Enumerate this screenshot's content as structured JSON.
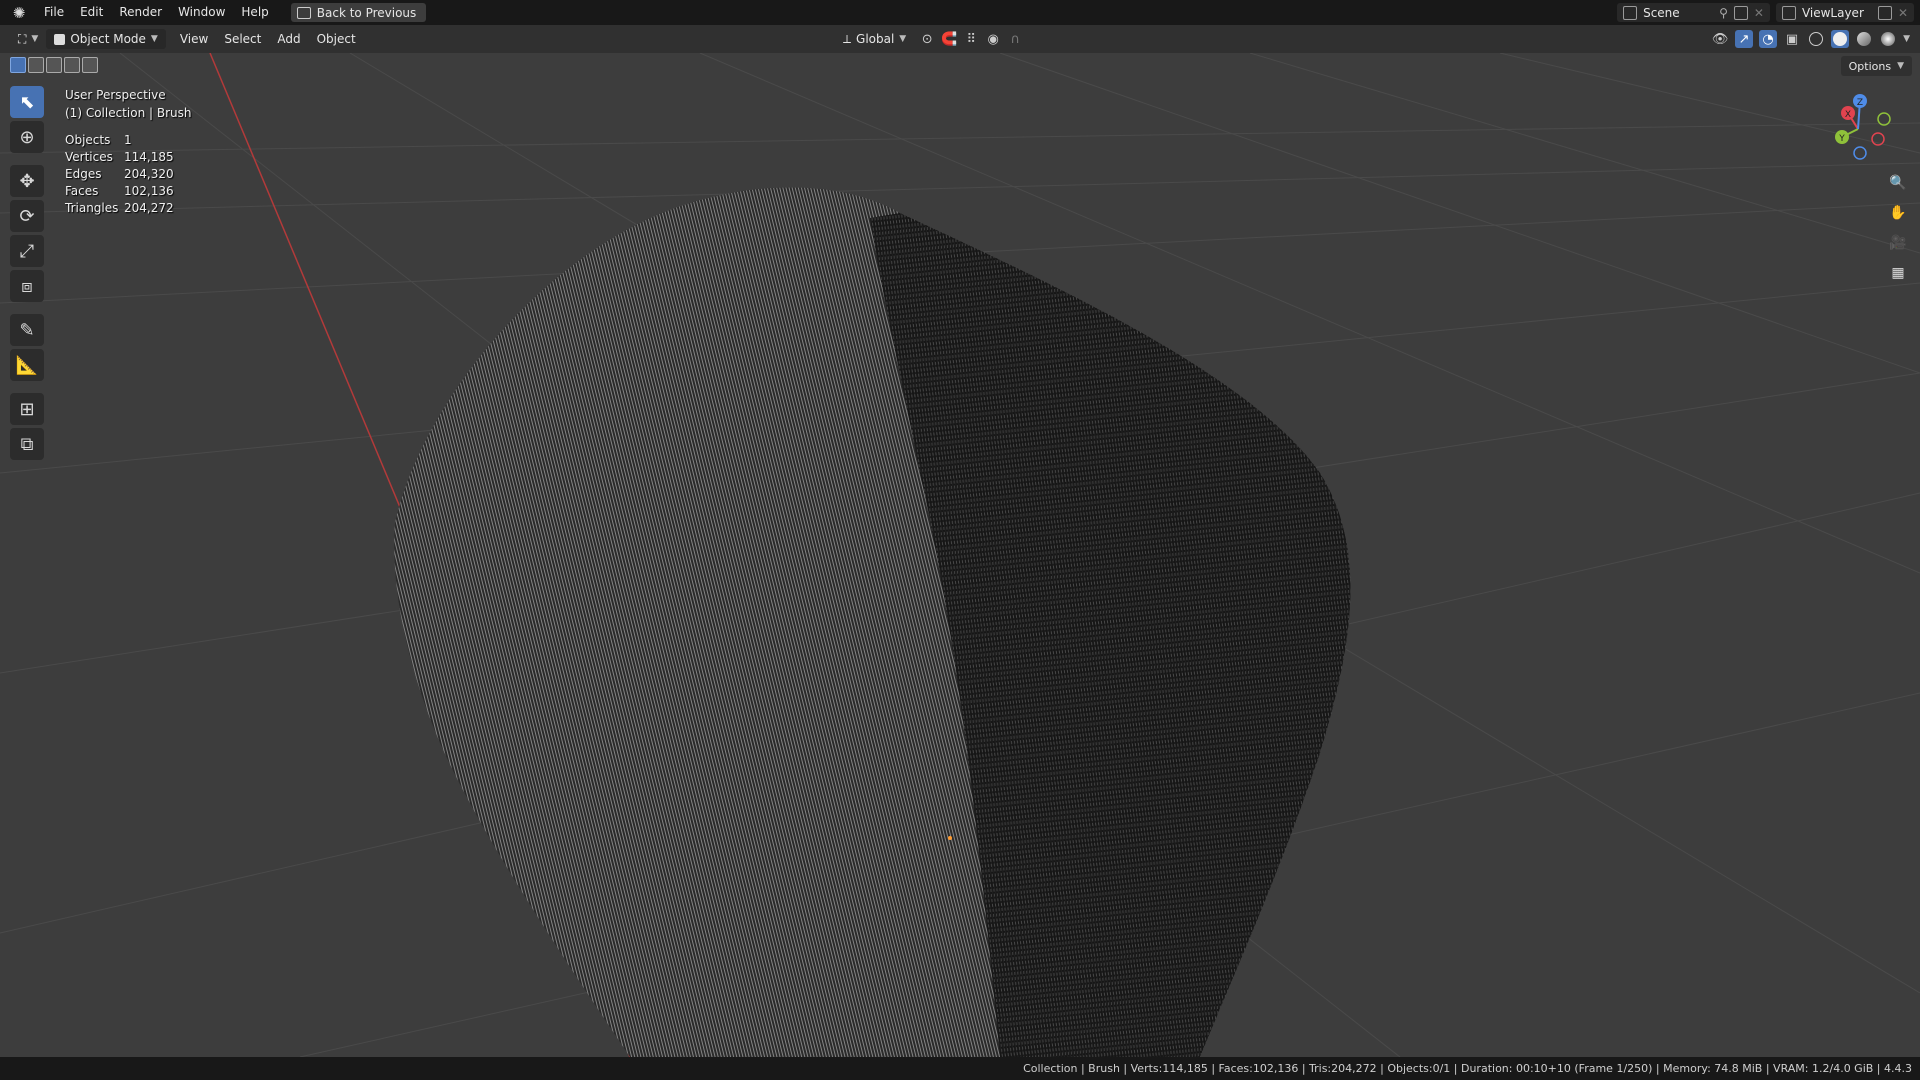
{
  "menubar": {
    "items": [
      "File",
      "Edit",
      "Render",
      "Window",
      "Help"
    ],
    "back_button": "Back to Previous",
    "scene": "Scene",
    "view_layer": "ViewLayer"
  },
  "header": {
    "mode": "Object Mode",
    "menus": [
      "View",
      "Select",
      "Add",
      "Object"
    ],
    "transform_orientation": "Global"
  },
  "viewport": {
    "options_label": "Options",
    "view_name": "User Perspective",
    "collection_info": "(1) Collection | Brush",
    "stats": [
      {
        "label": "Objects",
        "value": "1"
      },
      {
        "label": "Vertices",
        "value": "114,185"
      },
      {
        "label": "Edges",
        "value": "204,320"
      },
      {
        "label": "Faces",
        "value": "102,136"
      },
      {
        "label": "Triangles",
        "value": "204,272"
      }
    ],
    "gizmo": {
      "x": "X",
      "y": "Y",
      "z": "Z"
    }
  },
  "statusbar": {
    "text": "Collection | Brush | Verts:114,185 | Faces:102,136 | Tris:204,272 | Objects:0/1 | Duration: 00:10+10 (Frame 1/250) | Memory: 74.8 MiB | VRAM: 1.2/4.0 GiB | 4.4.3"
  },
  "colors": {
    "accent": "#4772b3",
    "x_axis": "#e0434f",
    "y_axis": "#8fc13a",
    "z_axis": "#4f8ce8",
    "viewport_bg": "#3d3d3d"
  }
}
